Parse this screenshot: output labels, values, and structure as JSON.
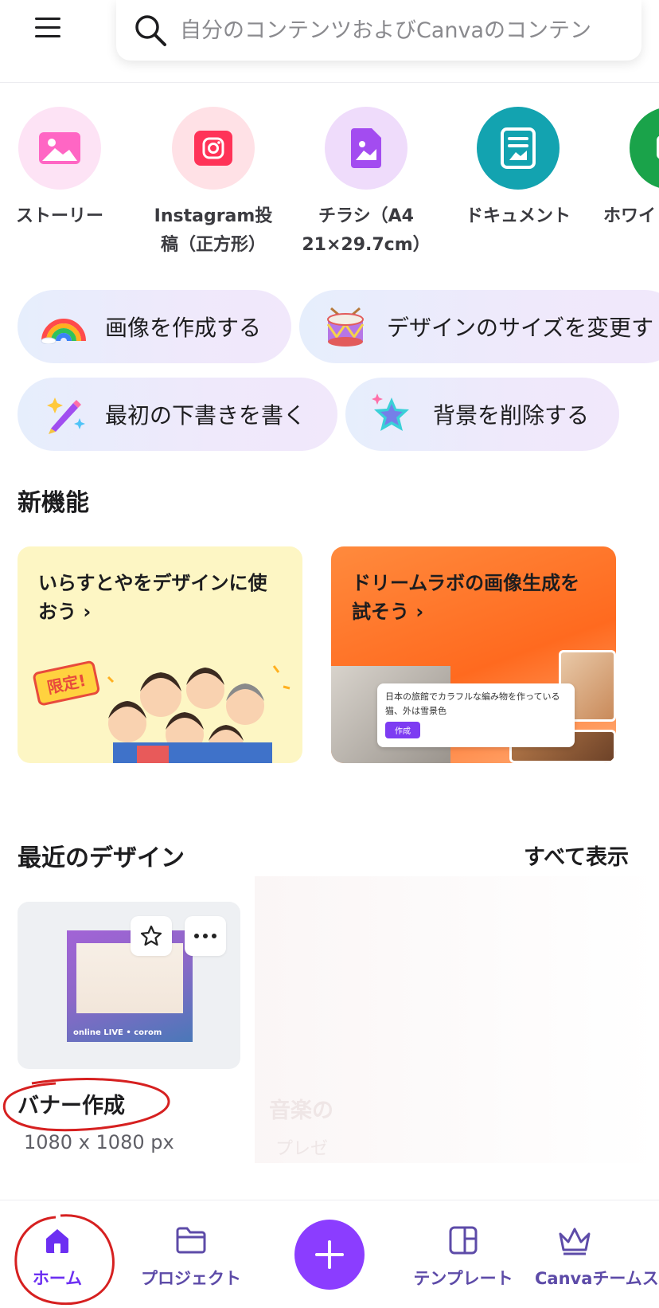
{
  "header": {
    "search_placeholder": "自分のコンテンツおよびCanvaのコンテン"
  },
  "design_types": [
    {
      "label": "ストーリー",
      "icon": "story-image-icon",
      "color": "#ff66c4"
    },
    {
      "label": "Instagram投\n稿（正方形）",
      "icon": "instagram-icon",
      "color": "#ff3358"
    },
    {
      "label": "チラシ（A4\n21×29.7cm）",
      "icon": "flyer-icon",
      "color": "#a34cf0"
    },
    {
      "label": "ドキュメント",
      "icon": "document-icon",
      "color": "#13a3b0"
    },
    {
      "label": "ホワイ",
      "icon": "whiteboard-icon",
      "color": "#1aa34a"
    }
  ],
  "quick_actions": [
    {
      "label": "画像を作成する",
      "icon": "rainbow-icon"
    },
    {
      "label": "デザインのサイズを変更す",
      "icon": "drum-icon"
    },
    {
      "label": "最初の下書きを書く",
      "icon": "magic-pen-icon"
    },
    {
      "label": "背景を削除する",
      "icon": "star-icon"
    }
  ],
  "new_features": {
    "title": "新機能",
    "cards": [
      {
        "title": "いらすとやをデザインに使おう ›",
        "badge": "限定!"
      },
      {
        "title": "ドリームラボの画像生成を試そう ›",
        "prompt_text": "日本の旅館でカラフルな編み物を作っている猫、外は雪景色",
        "button": "作成"
      }
    ]
  },
  "recent": {
    "title": "最近のデザイン",
    "see_all": "すべて表示",
    "items": [
      {
        "name": "バナー作成",
        "size": "1080 x 1080 px",
        "poster_text": "online LIVE • corom"
      },
      {
        "name": "音楽の",
        "size": "プレゼ"
      }
    ]
  },
  "bottom_nav": [
    {
      "label": "ホーム",
      "icon": "home-icon",
      "active": true
    },
    {
      "label": "プロジェクト",
      "icon": "folder-icon",
      "active": false
    },
    {
      "label": "テンプレート",
      "icon": "template-icon",
      "active": false
    },
    {
      "label": "Canvaチームス",
      "icon": "crown-icon",
      "active": false
    }
  ],
  "colors": {
    "accent": "#8b3dff",
    "annotation": "#d62020"
  }
}
